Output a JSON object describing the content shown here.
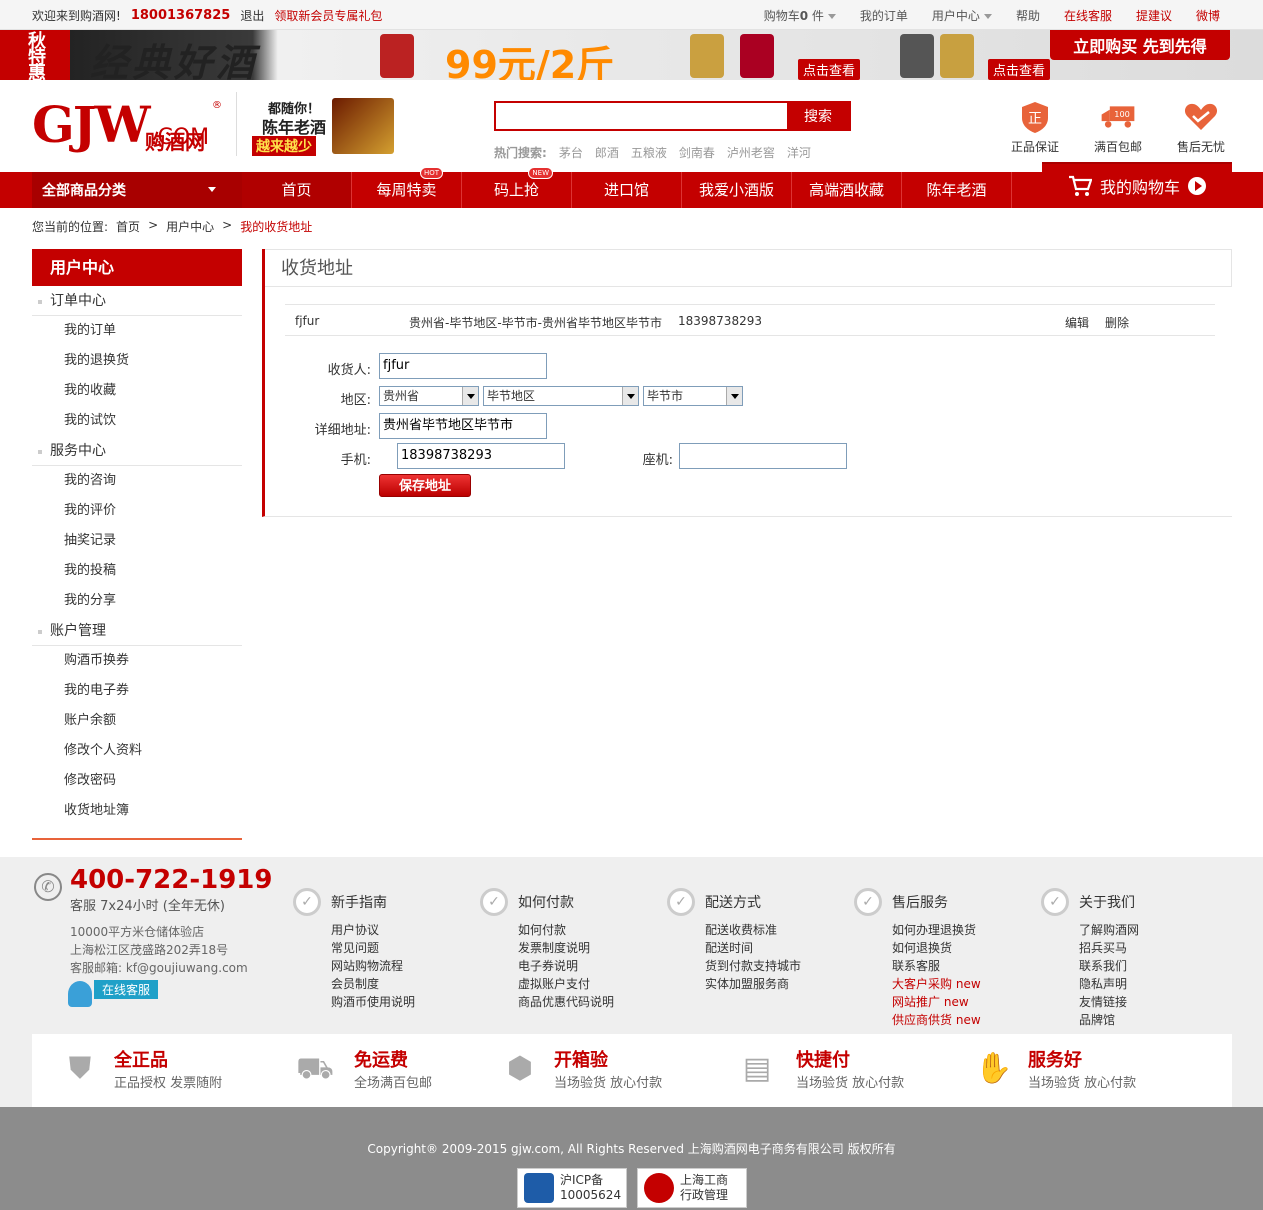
{
  "topbar": {
    "welcome": "欢迎来到购酒网!",
    "phone": "18001367825",
    "logout": "退出",
    "gift": "领取新会员专属礼包",
    "cart": "购物车",
    "cart_count": "0",
    "cart_unit": "件",
    "orders": "我的订单",
    "user_center": "用户中心",
    "help": "帮助",
    "online_service": "在线客服",
    "suggest": "提建议",
    "weibo": "微博"
  },
  "banner": {
    "badge": "秋特惠",
    "slogan": "经典好酒",
    "price": "99元/2斤",
    "look1": "点击查看",
    "look2": "点击查看",
    "cta": "立即购买 先到先得"
  },
  "header": {
    "logo_main": "GJW",
    "logo_com": ".COM",
    "logo_cn": "购酒网",
    "logo_reg": "®",
    "promo_line1": "都随你！",
    "promo_line2": "陈年老酒",
    "promo_line3": "越来越少",
    "search_placeholder": "",
    "search_btn": "搜索",
    "hot_label": "热门搜索:",
    "hot": [
      "茅台",
      "郎酒",
      "五粮液",
      "剑南春",
      "泸州老窖",
      "洋河"
    ],
    "svc": [
      "正品保证",
      "满百包邮",
      "售后无忧"
    ]
  },
  "nav": {
    "category": "全部商品分类",
    "items": [
      {
        "label": "首页",
        "tag": ""
      },
      {
        "label": "每周特卖",
        "tag": "HOT"
      },
      {
        "label": "码上抢",
        "tag": "NEW"
      },
      {
        "label": "进口馆",
        "tag": ""
      },
      {
        "label": "我爱小酒版",
        "tag": ""
      },
      {
        "label": "高端酒收藏",
        "tag": ""
      },
      {
        "label": "陈年老酒",
        "tag": ""
      }
    ],
    "cart": "我的购物车"
  },
  "breadcrumb": {
    "prefix": "您当前的位置:",
    "home": "首页",
    "sep1": ">",
    "user": "用户中心",
    "sep2": ">",
    "current": "我的收货地址"
  },
  "sidebar": {
    "title": "用户中心",
    "groups": [
      {
        "name": "订单中心",
        "items": [
          "我的订单",
          "我的退换货",
          "我的收藏",
          "我的试饮"
        ]
      },
      {
        "name": "服务中心",
        "items": [
          "我的咨询",
          "我的评价",
          "抽奖记录",
          "我的投稿",
          "我的分享"
        ]
      },
      {
        "name": "账户管理",
        "items": [
          "购酒币换券",
          "我的电子券",
          "账户余额",
          "修改个人资料",
          "修改密码",
          "收货地址簿"
        ]
      }
    ]
  },
  "main": {
    "title": "收货地址",
    "address_row": {
      "name": "fjfur",
      "address": "贵州省-毕节地区-毕节市-贵州省毕节地区毕节市",
      "phone": "18398738293",
      "edit": "编辑",
      "delete": "删除"
    },
    "form": {
      "receiver_label": "收货人:",
      "receiver_value": "fjfur",
      "region_label": "地区:",
      "province": "贵州省",
      "city": "毕节地区",
      "district": "毕节市",
      "detail_label": "详细地址:",
      "detail_value": "贵州省毕节地区毕节市",
      "mobile_label": "手机:",
      "mobile_value": "18398738293",
      "tel_label": "座机:",
      "tel_value": "",
      "save": "保存地址"
    }
  },
  "footer": {
    "tel": "400-722-1919",
    "service_hours": "客服 7x24小时 (全年无休)",
    "addr1": "10000平方米仓储体验店",
    "addr2": "上海松江区茂盛路202弄18号",
    "email": "客服邮箱: kf@goujiuwang.com",
    "online": "在线客服",
    "cols": [
      {
        "title": "新手指南",
        "links": [
          {
            "t": "用户协议",
            "n": ""
          },
          {
            "t": "常见问题",
            "n": ""
          },
          {
            "t": "网站购物流程",
            "n": ""
          },
          {
            "t": "会员制度",
            "n": ""
          },
          {
            "t": "购酒币使用说明",
            "n": ""
          }
        ]
      },
      {
        "title": "如何付款",
        "links": [
          {
            "t": "如何付款",
            "n": ""
          },
          {
            "t": "发票制度说明",
            "n": ""
          },
          {
            "t": "电子券说明",
            "n": ""
          },
          {
            "t": "虚拟账户支付",
            "n": ""
          },
          {
            "t": "商品优惠代码说明",
            "n": ""
          }
        ]
      },
      {
        "title": "配送方式",
        "links": [
          {
            "t": "配送收费标准",
            "n": ""
          },
          {
            "t": "配送时间",
            "n": ""
          },
          {
            "t": "货到付款支持城市",
            "n": ""
          },
          {
            "t": "实体加盟服务商",
            "n": ""
          }
        ]
      },
      {
        "title": "售后服务",
        "links": [
          {
            "t": "如何办理退换货",
            "n": ""
          },
          {
            "t": "如何退换货",
            "n": ""
          },
          {
            "t": "联系客服",
            "n": ""
          },
          {
            "t": "大客户采购",
            "n": "new"
          },
          {
            "t": "网站推广",
            "n": "new"
          },
          {
            "t": "供应商供货",
            "n": "new"
          }
        ]
      },
      {
        "title": "关于我们",
        "links": [
          {
            "t": "了解购酒网",
            "n": ""
          },
          {
            "t": "招兵买马",
            "n": ""
          },
          {
            "t": "联系我们",
            "n": ""
          },
          {
            "t": "隐私声明",
            "n": ""
          },
          {
            "t": "友情链接",
            "n": ""
          },
          {
            "t": "品牌馆",
            "n": ""
          }
        ]
      }
    ],
    "guarantees": [
      {
        "t1": "全正品",
        "t2": "正品授权 发票随附",
        "icon": "shield-icon"
      },
      {
        "t1": "免运费",
        "t2": "全场满百包邮",
        "icon": "truck-icon"
      },
      {
        "t1": "开箱验",
        "t2": "当场验货 放心付款",
        "icon": "box-icon"
      },
      {
        "t1": "快捷付",
        "t2": "当场验货 放心付款",
        "icon": "card-icon"
      },
      {
        "t1": "服务好",
        "t2": "当场验货 放心付款",
        "icon": "thumbs-up-icon"
      }
    ],
    "copyright": "Copyright® 2009-2015 gjw.com, All Rights Reserved 上海购酒网电子商务有限公司 版权所有",
    "badge1_l1": "沪ICP备",
    "badge1_l2": "10005624",
    "badge2_l1": "上海工商",
    "badge2_l2": "行政管理"
  },
  "colors": {
    "brand": "#c40000",
    "accent": "#e8633a"
  }
}
